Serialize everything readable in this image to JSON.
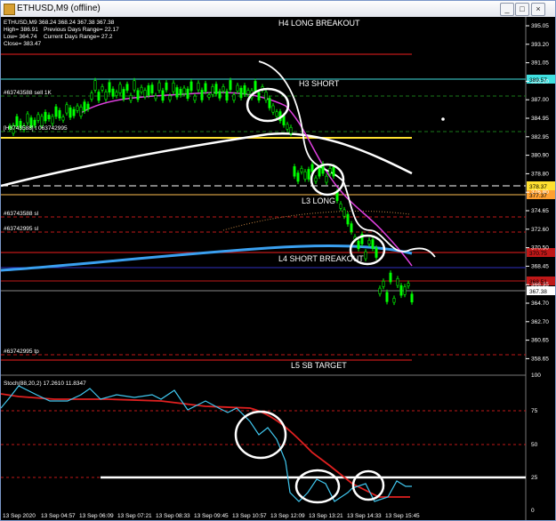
{
  "window": {
    "title": "ETHUSD,M9 (offline)",
    "buttons": [
      "_",
      "□",
      "×"
    ]
  },
  "info": {
    "line1": "ETHUSD,M9 368.24 368.24 367.38 367.38",
    "high": "High= 386.91",
    "prev_range": "Previous Days Range= 22.17",
    "low": "Low= 364.74",
    "cur_range": "Current Days Range= 27.2",
    "close": "Close= 383.47"
  },
  "levels": {
    "h4": "H4 LONG BREAKOUT",
    "h3": "H3 SHORT",
    "l3": "L3 LONG",
    "l4": "L4 SHORT BREAKOUT",
    "l5": "L5 SB TARGET"
  },
  "order_labels": {
    "sell": "#63743588 sell 1K",
    "sl1": "#63743588 sl",
    "sl2": "#63742995 sl",
    "tp": "#63742995 tp",
    "blend": "[H3743588] t 063742995"
  },
  "price_ticks": [
    "395.05",
    "393.20",
    "391.05",
    "389.20",
    "387.00",
    "384.95",
    "382.95",
    "380.90",
    "378.80",
    "376.80",
    "374.65",
    "372.60",
    "370.50",
    "368.45",
    "366.35",
    "364.70",
    "362.70",
    "360.65",
    "358.65"
  ],
  "price_badges": {
    "blue": "389.57",
    "yellow": "378.37",
    "orange": "377.37",
    "red1": "370.75",
    "red2": "368.51",
    "white": "367.38"
  },
  "stoch": {
    "label": "Stoch(88,20,2) 17.2610 11.8347",
    "ticks": [
      "100",
      "75",
      "50",
      "25",
      "0"
    ]
  },
  "time_labels": [
    "13 Sep 2020",
    "13 Sep 04:57",
    "13 Sep 06:09",
    "13 Sep 07:21",
    "13 Sep 08:33",
    "13 Sep 09:45",
    "13 Sep 10:57",
    "13 Sep 12:09",
    "13 Sep 13:21",
    "13 Sep 14:33",
    "13 Sep 15:45"
  ],
  "colors": {
    "up_candle": "#00ff00",
    "magenta_ma": "#e040e0",
    "blue_ma": "#3aa0f0",
    "stoch_main": "#40c8f0",
    "stoch_signal": "#e02020"
  }
}
